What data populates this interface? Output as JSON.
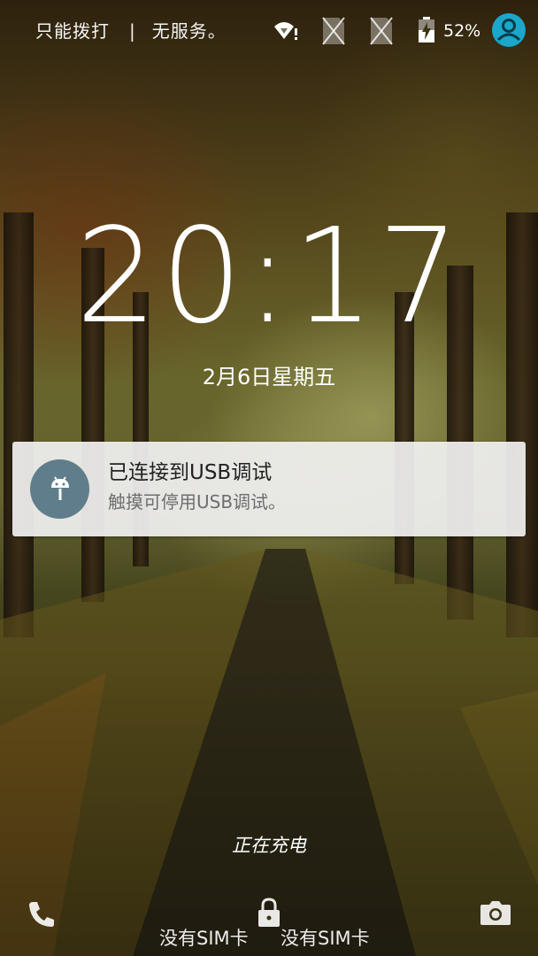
{
  "status_bar": {
    "carrier_left": "只能拨打",
    "separator": "|",
    "carrier_right": "无服务。",
    "battery_percent": "52%",
    "icons": [
      "wifi-no-internet-icon",
      "no-sim-icon",
      "no-sim-icon",
      "battery-charging-icon",
      "user-avatar-icon"
    ]
  },
  "lockscreen": {
    "time": "20:17",
    "date": "2月6日星期五"
  },
  "notification": {
    "icon": "android-debug-icon",
    "icon_color": "#607d8b",
    "title": "已连接到USB调试",
    "text": "触摸可停用USB调试。"
  },
  "charging_text": "正在充电",
  "bottom": {
    "left_icon": "phone-icon",
    "center_icon": "lock-icon",
    "right_icon": "camera-icon",
    "sim_status_1": "没有SIM卡",
    "sim_status_2": "没有SIM卡"
  },
  "colors": {
    "notification_bg": "#f0f0f0",
    "avatar_accent": "#1aa7c9"
  }
}
